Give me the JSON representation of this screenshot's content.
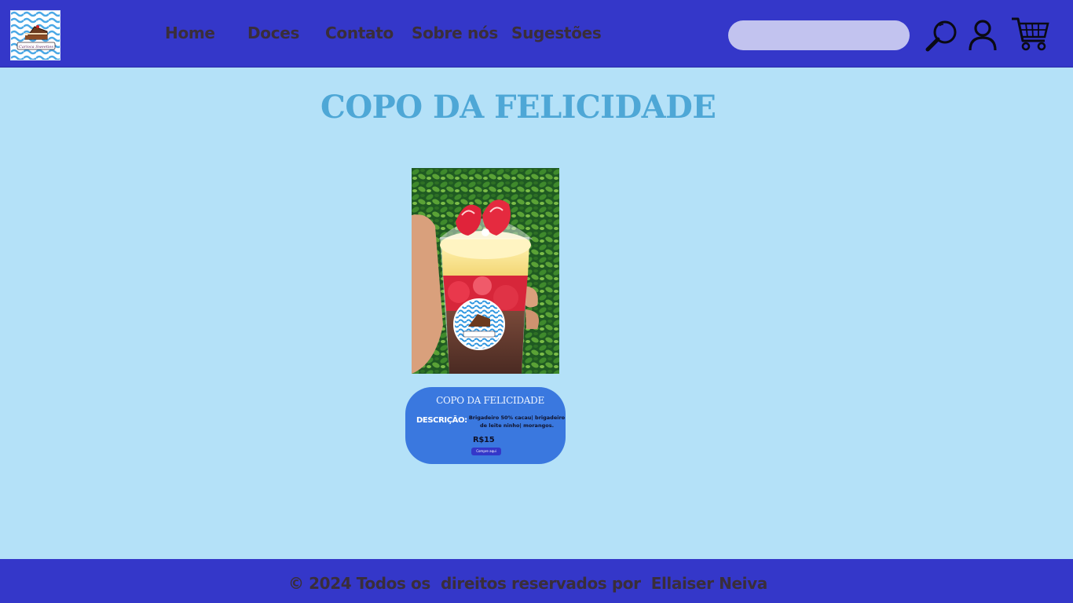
{
  "header": {
    "logo_text": "Carioca Sweeties",
    "nav": [
      {
        "label": "Home"
      },
      {
        "label": "Doces"
      },
      {
        "label": "Contato"
      },
      {
        "label": "Sobre nós"
      },
      {
        "label": "Sugestões"
      }
    ],
    "search": {
      "value": "",
      "placeholder": ""
    },
    "icons": [
      "search-icon",
      "user-icon",
      "cart-icon"
    ]
  },
  "main": {
    "title": "COPO DA FELICIDADE",
    "product": {
      "card_title": "COPO DA FELICIDADE",
      "description_label": "DESCRIÇÃO:",
      "description": "Brigadeiro 50% cacau| brigadeiro de leite ninho| morangos.",
      "price": "R$15",
      "buy_label": "Compre aqui"
    }
  },
  "footer": {
    "copyright": "© 2024 Todos os  direitos reservados por  Ellaiser Neiva"
  },
  "colors": {
    "header_bg": "#3437c9",
    "page_bg": "#b4e1f8",
    "title": "#4ea7d6",
    "card_bg": "#3a78df",
    "search_bg": "#c2c3ef"
  }
}
